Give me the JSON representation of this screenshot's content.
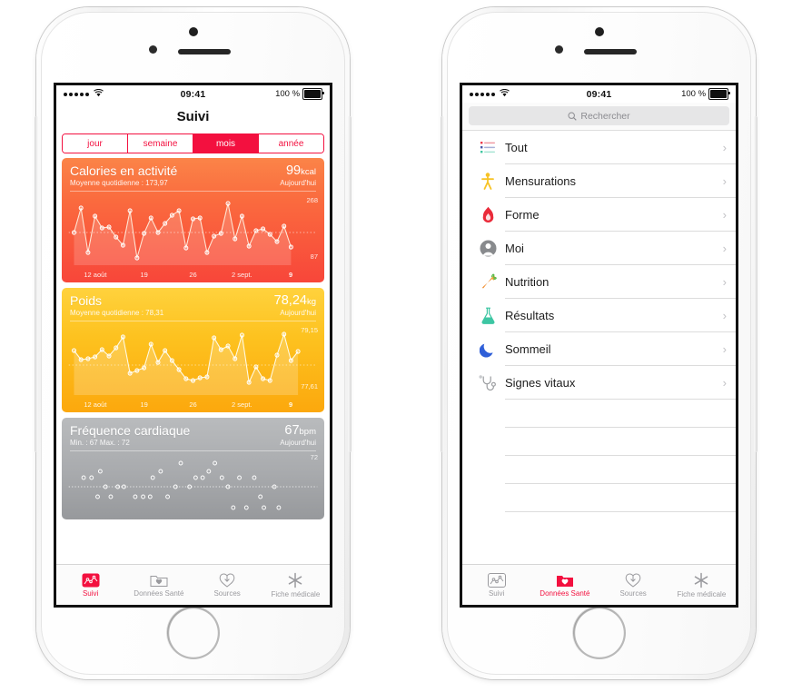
{
  "status_bar": {
    "time": "09:41",
    "battery_text": "100 %",
    "signal_dots": 5
  },
  "left_phone": {
    "nav_title": "Suivi",
    "segments": [
      {
        "label": "jour",
        "selected": false
      },
      {
        "label": "semaine",
        "selected": false
      },
      {
        "label": "mois",
        "selected": true
      },
      {
        "label": "année",
        "selected": false
      }
    ],
    "cards": [
      {
        "title": "Calories en activité",
        "subtitle": "Moyenne quotidienne : 173,97",
        "value": "99",
        "unit": "kcal",
        "when": "Aujourd'hui",
        "y_max": "268",
        "y_min": "87",
        "x_labels": [
          "12 août",
          "19",
          "26",
          "2 sept.",
          "9"
        ]
      },
      {
        "title": "Poids",
        "subtitle": "Moyenne quotidienne : 78,31",
        "value": "78,24",
        "unit": "kg",
        "when": "Aujourd'hui",
        "y_max": "79,15",
        "y_min": "77,61",
        "x_labels": [
          "12 août",
          "19",
          "26",
          "2 sept.",
          "9"
        ]
      },
      {
        "title": "Fréquence cardiaque",
        "subtitle": "Min. : 67  Max. : 72",
        "value": "67",
        "unit": "bpm",
        "when": "Aujourd'hui",
        "y_max": "72",
        "y_min": "",
        "x_labels": []
      }
    ],
    "tabs": [
      {
        "label": "Suivi",
        "icon": "activity-chart-icon",
        "active": true
      },
      {
        "label": "Données Santé",
        "icon": "folder-heart-icon",
        "active": false
      },
      {
        "label": "Sources",
        "icon": "download-heart-icon",
        "active": false
      },
      {
        "label": "Fiche médicale",
        "icon": "medical-star-icon",
        "active": false
      }
    ]
  },
  "right_phone": {
    "search": {
      "placeholder": "Rechercher",
      "icon": "search-icon"
    },
    "list_items": [
      {
        "label": "Tout",
        "icon": "list-bullets-icon"
      },
      {
        "label": "Mensurations",
        "icon": "body-person-icon"
      },
      {
        "label": "Forme",
        "icon": "flame-icon"
      },
      {
        "label": "Moi",
        "icon": "person-avatar-icon"
      },
      {
        "label": "Nutrition",
        "icon": "carrot-icon"
      },
      {
        "label": "Résultats",
        "icon": "flask-icon"
      },
      {
        "label": "Sommeil",
        "icon": "moon-icon"
      },
      {
        "label": "Signes vitaux",
        "icon": "stethoscope-icon"
      }
    ],
    "chevron": "›",
    "tabs": [
      {
        "label": "Suivi",
        "icon": "activity-chart-icon",
        "active": false
      },
      {
        "label": "Données Santé",
        "icon": "folder-heart-icon",
        "active": true
      },
      {
        "label": "Sources",
        "icon": "download-heart-icon",
        "active": false
      },
      {
        "label": "Fiche médicale",
        "icon": "medical-star-icon",
        "active": false
      }
    ]
  },
  "colors": {
    "accent_red": "#f3103f",
    "calories_card": "#fa6a3e",
    "weight_card": "#fdc21f",
    "hr_card": "#a8aaad"
  },
  "chart_data": [
    {
      "type": "line",
      "title": "Calories en activité",
      "ylabel": "kcal",
      "ylim": [
        87,
        268
      ],
      "x_tick_labels": [
        "12 août",
        "19",
        "26",
        "2 sept.",
        "9"
      ],
      "average": 173.97,
      "values": [
        172,
        230,
        110,
        214,
        163,
        166,
        143,
        127,
        213,
        97,
        152,
        200,
        163,
        186,
        203,
        213,
        131,
        202,
        204,
        119,
        156,
        162,
        244,
        144,
        205,
        128,
        158,
        163,
        150,
        136,
        168,
        128
      ]
    },
    {
      "type": "line",
      "title": "Poids",
      "ylabel": "kg",
      "ylim": [
        77.61,
        79.15
      ],
      "x_tick_labels": [
        "12 août",
        "19",
        "26",
        "2 sept.",
        "9"
      ],
      "average": 78.31,
      "values": [
        78.45,
        78.28,
        78.32,
        78.31,
        78.42,
        78.34,
        78.44,
        78.71,
        78.0,
        78.05,
        78.12,
        78.62,
        78.2,
        78.42,
        78.25,
        78.1,
        77.92,
        77.88,
        77.85,
        77.9,
        78.73,
        78.5,
        78.62,
        78.38,
        78.72,
        77.85,
        78.1,
        77.88,
        77.85,
        78.35,
        78.75,
        78.3,
        78.42
      ]
    },
    {
      "type": "scatter",
      "title": "Fréquence cardiaque",
      "ylabel": "bpm",
      "ylim": [
        67,
        72
      ],
      "average": 69,
      "points": [
        68,
        68,
        70,
        69,
        68.2,
        68.2,
        66.8,
        66.8,
        69,
        71,
        70.5,
        66.8,
        66.8,
        66.8,
        67,
        68.6,
        68.6,
        69,
        69,
        70.5,
        71.5,
        68.5,
        69.4,
        68.5,
        68.6,
        69,
        68.6,
        66.8,
        66.5,
        66.5,
        68.6,
        66.3,
        66.3,
        68.6,
        66.3,
        66.3
      ]
    }
  ]
}
